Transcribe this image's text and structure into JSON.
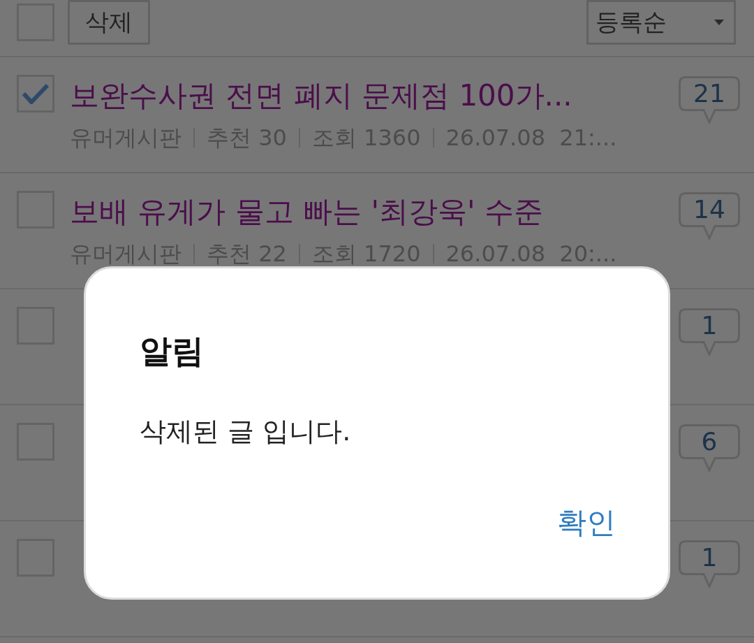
{
  "toolbar": {
    "select_all": {
      "checked": false
    },
    "delete_button": {
      "label": "삭제"
    },
    "sort_select": {
      "value": "등록순"
    }
  },
  "posts": [
    {
      "checked": true,
      "title": "보완수사권 전면 폐지 문제점 100가...",
      "board": "유머게시판",
      "recommend": "추천 30",
      "views": "조회 1360",
      "date": "26.07.08  21:...",
      "comments": "21"
    },
    {
      "checked": false,
      "title": "보배 유게가 물고 빠는 '최강욱' 수준",
      "board": "유머게시판",
      "recommend": "추천 22",
      "views": "조회 1720",
      "date": "26.07.08  20:...",
      "comments": "14"
    },
    {
      "checked": false,
      "comments": "1"
    },
    {
      "checked": false,
      "comments": "6"
    },
    {
      "checked": false,
      "comments": "1"
    }
  ],
  "dialog": {
    "title": "알림",
    "message": "삭제된 글 입니다.",
    "buttons": [
      "확인"
    ]
  }
}
